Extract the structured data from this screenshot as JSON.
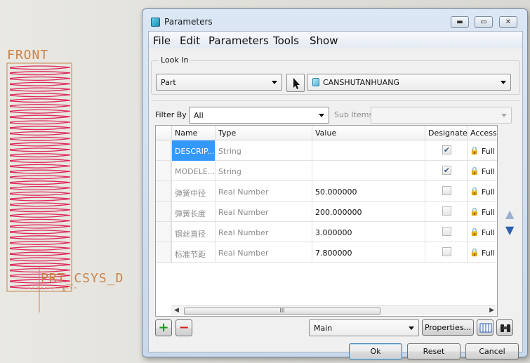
{
  "viewport": {
    "front_label": "FRONT",
    "csys_label": "PRT_CSYS_D",
    "axis_marker": "X"
  },
  "dialog": {
    "title": "Parameters",
    "window_buttons": {
      "minimize": "▬",
      "maximize": "▭",
      "close": "✕"
    },
    "menu": [
      "File",
      "Edit",
      "Parameters",
      "Tools",
      "Show"
    ],
    "look_in": {
      "label": "Look In",
      "scope_value": "Part",
      "model_value": "CANSHUTANHUANG"
    },
    "filter": {
      "label": "Filter By",
      "value": "All",
      "sub_items_label": "Sub Items"
    },
    "table": {
      "headers": [
        "Name",
        "Type",
        "Value",
        "Designate",
        "Access"
      ],
      "rows": [
        {
          "name": "DESCRIP...",
          "type": "String",
          "value": "",
          "designate": true,
          "access": "Full"
        },
        {
          "name": "MODELE...",
          "type": "String",
          "value": "",
          "designate": true,
          "access": "Full"
        },
        {
          "name": "弹簧中径",
          "type": "Real Number",
          "value": "50.000000",
          "designate": false,
          "access": "Full"
        },
        {
          "name": "弹簧长度",
          "type": "Real Number",
          "value": "200.000000",
          "designate": false,
          "access": "Full"
        },
        {
          "name": "钢丝直径",
          "type": "Real Number",
          "value": "3.000000",
          "designate": false,
          "access": "Full"
        },
        {
          "name": "标准节距",
          "type": "Real Number",
          "value": "7.800000",
          "designate": false,
          "access": "Full"
        }
      ],
      "scrollbar_grip": "III"
    },
    "bottom": {
      "add_symbol": "+",
      "remove_symbol": "−",
      "main_value": "Main",
      "properties_label": "Properties...",
      "ok_label": "Ok",
      "reset_label": "Reset",
      "cancel_label": "Cancel"
    },
    "colors": {
      "selection": "#3399ff",
      "add_green": "#1a9a1a",
      "remove_red": "#d42020",
      "arrow_blue": "#2b5fb0"
    }
  }
}
